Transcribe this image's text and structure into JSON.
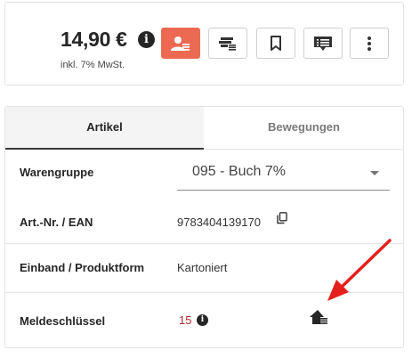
{
  "price": {
    "value": "14,90 €",
    "info_glyph": "i",
    "note": "inkl. 7% MwSt."
  },
  "toolbar": {
    "buttons": [
      {
        "icon": "customer-order-icon",
        "color": "#ec6a52",
        "active": true
      },
      {
        "icon": "stock-list-icon"
      },
      {
        "icon": "bookmark-icon"
      },
      {
        "icon": "list-flag-icon"
      },
      {
        "icon": "more-vertical-icon"
      }
    ]
  },
  "tabs": [
    {
      "label": "Artikel",
      "active": true
    },
    {
      "label": "Bewegungen",
      "active": false
    }
  ],
  "fields": {
    "warengruppe": {
      "label": "Warengruppe",
      "value": "095 - Buch 7%"
    },
    "artnr": {
      "label": "Art.-Nr. / EAN",
      "value": "9783404139170"
    },
    "einband": {
      "label": "Einband / Produktform",
      "value": "Kartoniert"
    },
    "meldeschluessel": {
      "label": "Meldeschlüssel",
      "value": "15",
      "value_color": "#b02a2a",
      "info_glyph": "i"
    }
  },
  "annotation": {
    "arrow_color": "#e3201b"
  }
}
